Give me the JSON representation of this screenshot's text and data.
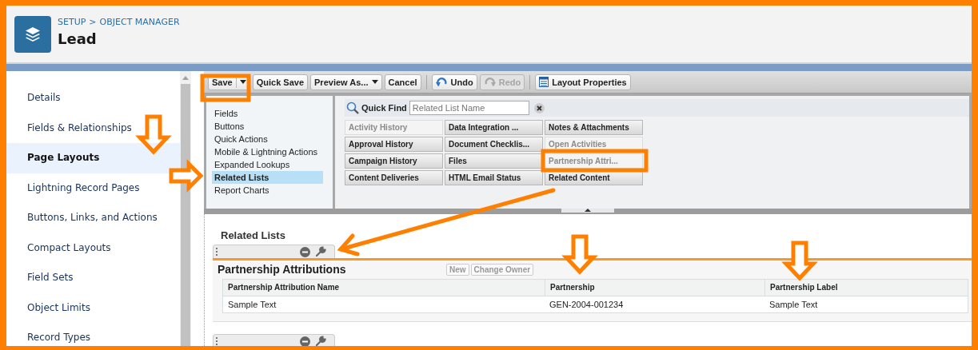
{
  "header": {
    "breadcrumb": [
      "SETUP",
      "OBJECT MANAGER"
    ],
    "breadcrumb_separator": ">",
    "title": "Lead"
  },
  "sidebar": {
    "items": [
      {
        "label": "Details",
        "selected": false
      },
      {
        "label": "Fields & Relationships",
        "selected": false
      },
      {
        "label": "Page Layouts",
        "selected": true
      },
      {
        "label": "Lightning Record Pages",
        "selected": false
      },
      {
        "label": "Buttons, Links, and Actions",
        "selected": false
      },
      {
        "label": "Compact Layouts",
        "selected": false
      },
      {
        "label": "Field Sets",
        "selected": false
      },
      {
        "label": "Object Limits",
        "selected": false
      },
      {
        "label": "Record Types",
        "selected": false
      }
    ]
  },
  "toolbar": [
    {
      "label": "Save",
      "kind": "split",
      "disabled": false
    },
    {
      "label": "Quick Save",
      "kind": "plain",
      "disabled": false
    },
    {
      "label": "Preview As...",
      "kind": "dropdown",
      "disabled": false
    },
    {
      "label": "Cancel",
      "kind": "plain",
      "disabled": false
    },
    {
      "label": "Undo",
      "kind": "undo",
      "disabled": false
    },
    {
      "label": "Redo",
      "kind": "redo",
      "disabled": true
    },
    {
      "label": "Layout Properties",
      "kind": "properties",
      "disabled": false
    }
  ],
  "palette": {
    "categories": [
      {
        "label": "Fields",
        "selected": false
      },
      {
        "label": "Buttons",
        "selected": false
      },
      {
        "label": "Quick Actions",
        "selected": false
      },
      {
        "label": "Mobile & Lightning Actions",
        "selected": false
      },
      {
        "label": "Expanded Lookups",
        "selected": false
      },
      {
        "label": "Related Lists",
        "selected": true
      },
      {
        "label": "Report Charts",
        "selected": false
      }
    ],
    "quick_find": {
      "label": "Quick Find",
      "placeholder": "Related List Name"
    },
    "items": [
      {
        "label": "Activity History",
        "disabled": true
      },
      {
        "label": "Data Integration ...",
        "disabled": false
      },
      {
        "label": "Notes & Attachments",
        "disabled": false
      },
      {
        "label": "Approval History",
        "disabled": false
      },
      {
        "label": "Document Checklis...",
        "disabled": false
      },
      {
        "label": "Open Activities",
        "disabled": true
      },
      {
        "label": "Campaign History",
        "disabled": false
      },
      {
        "label": "Files",
        "disabled": false
      },
      {
        "label": "Partnership Attri...",
        "disabled": true
      },
      {
        "label": "Content Deliveries",
        "disabled": false
      },
      {
        "label": "HTML Email Status",
        "disabled": false
      },
      {
        "label": "Related Content",
        "disabled": false
      }
    ]
  },
  "layout": {
    "section_title": "Related Lists",
    "related_list": {
      "title": "Partnership Attributions",
      "buttons": [
        "New",
        "Change Owner"
      ],
      "columns": [
        "Partnership Attribution Name",
        "Partnership",
        "Partnership Label"
      ],
      "rows": [
        [
          "Sample Text",
          "GEN-2004-001234",
          "Sample Text"
        ]
      ]
    }
  }
}
